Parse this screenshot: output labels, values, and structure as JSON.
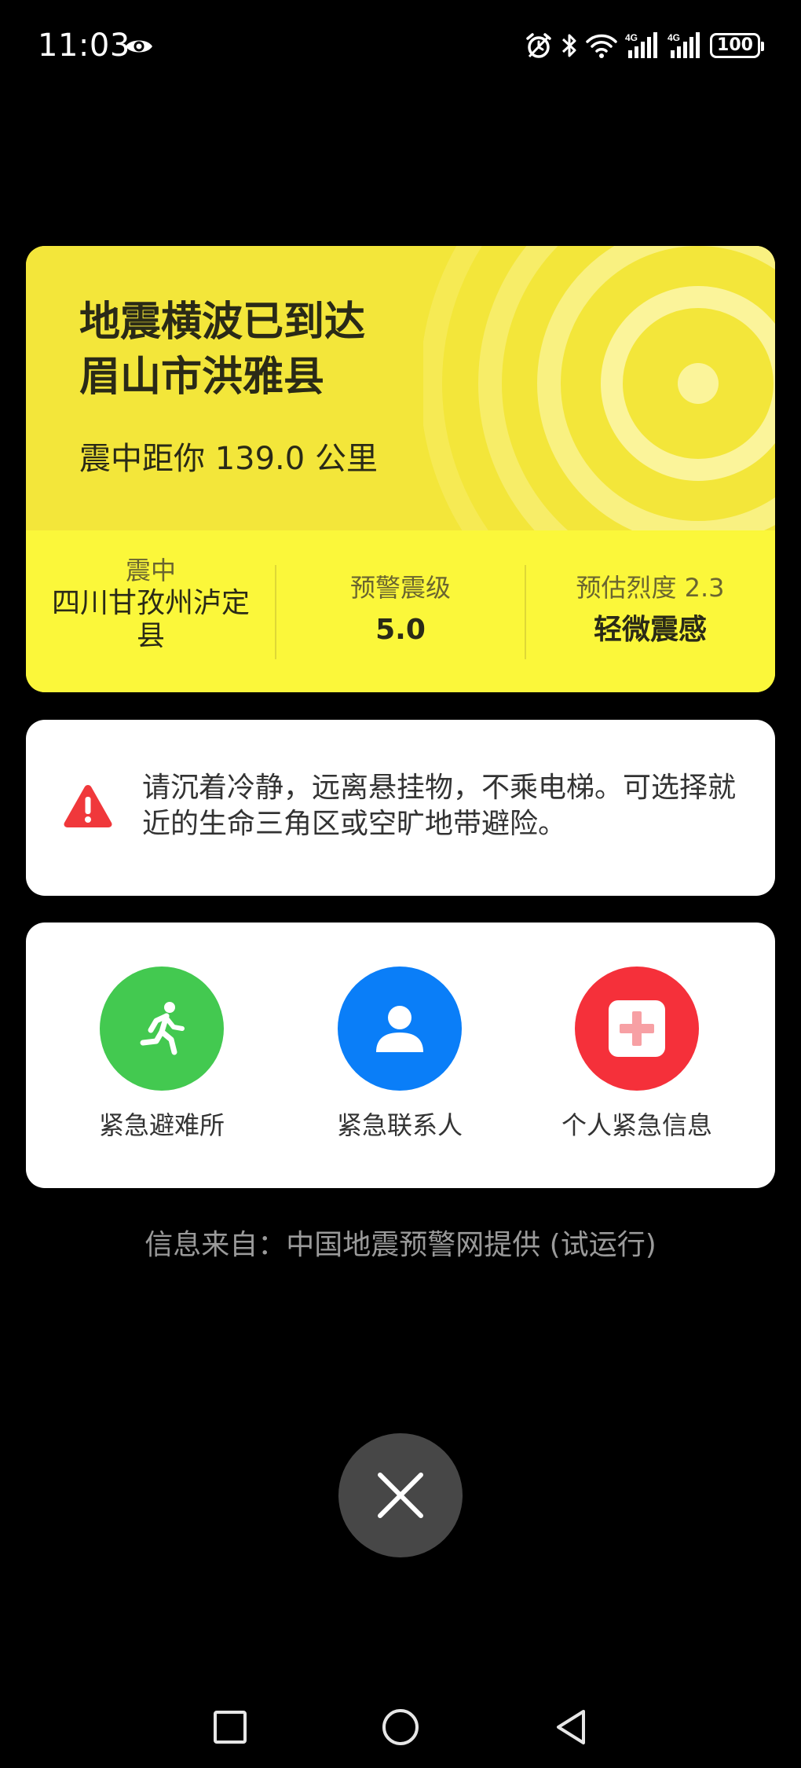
{
  "status_bar": {
    "time": "11:03",
    "battery": "100",
    "icons": [
      "eye-icon",
      "alarm-icon",
      "bluetooth-icon",
      "wifi-icon",
      "signal-4g-icon",
      "signal-4g-icon",
      "battery-icon"
    ]
  },
  "alert": {
    "title_line1": "地震横波已到达",
    "title_line2": "眉山市洪雅县",
    "distance": "震中距你 139.0 公里",
    "stats": {
      "epicenter_label": "震中",
      "epicenter_value": "四川甘孜州泸定县",
      "magnitude_label": "预警震级",
      "magnitude_value": "5.0",
      "intensity_label": "预估烈度 2.3",
      "intensity_value": "轻微震感"
    },
    "colors": {
      "top": "#f3e63a",
      "bottom": "#fbf73a"
    }
  },
  "advice": {
    "icon": "warning-triangle-icon",
    "text": "请沉着冷静，远离悬挂物，不乘电梯。可选择就近的生命三角区或空旷地带避险。",
    "color": "#f0383b"
  },
  "actions": [
    {
      "label": "紧急避难所",
      "icon": "running-person-icon",
      "color": "#43c950"
    },
    {
      "label": "紧急联系人",
      "icon": "person-icon",
      "color": "#0a7ef8"
    },
    {
      "label": "个人紧急信息",
      "icon": "medical-cross-icon",
      "color": "#f5303a"
    }
  ],
  "source": "信息来自：中国地震预警网提供 (试运行)",
  "close_icon": "close-icon",
  "nav": {
    "recent_icon": "recent-apps-icon",
    "home_icon": "home-icon",
    "back_icon": "back-icon"
  }
}
